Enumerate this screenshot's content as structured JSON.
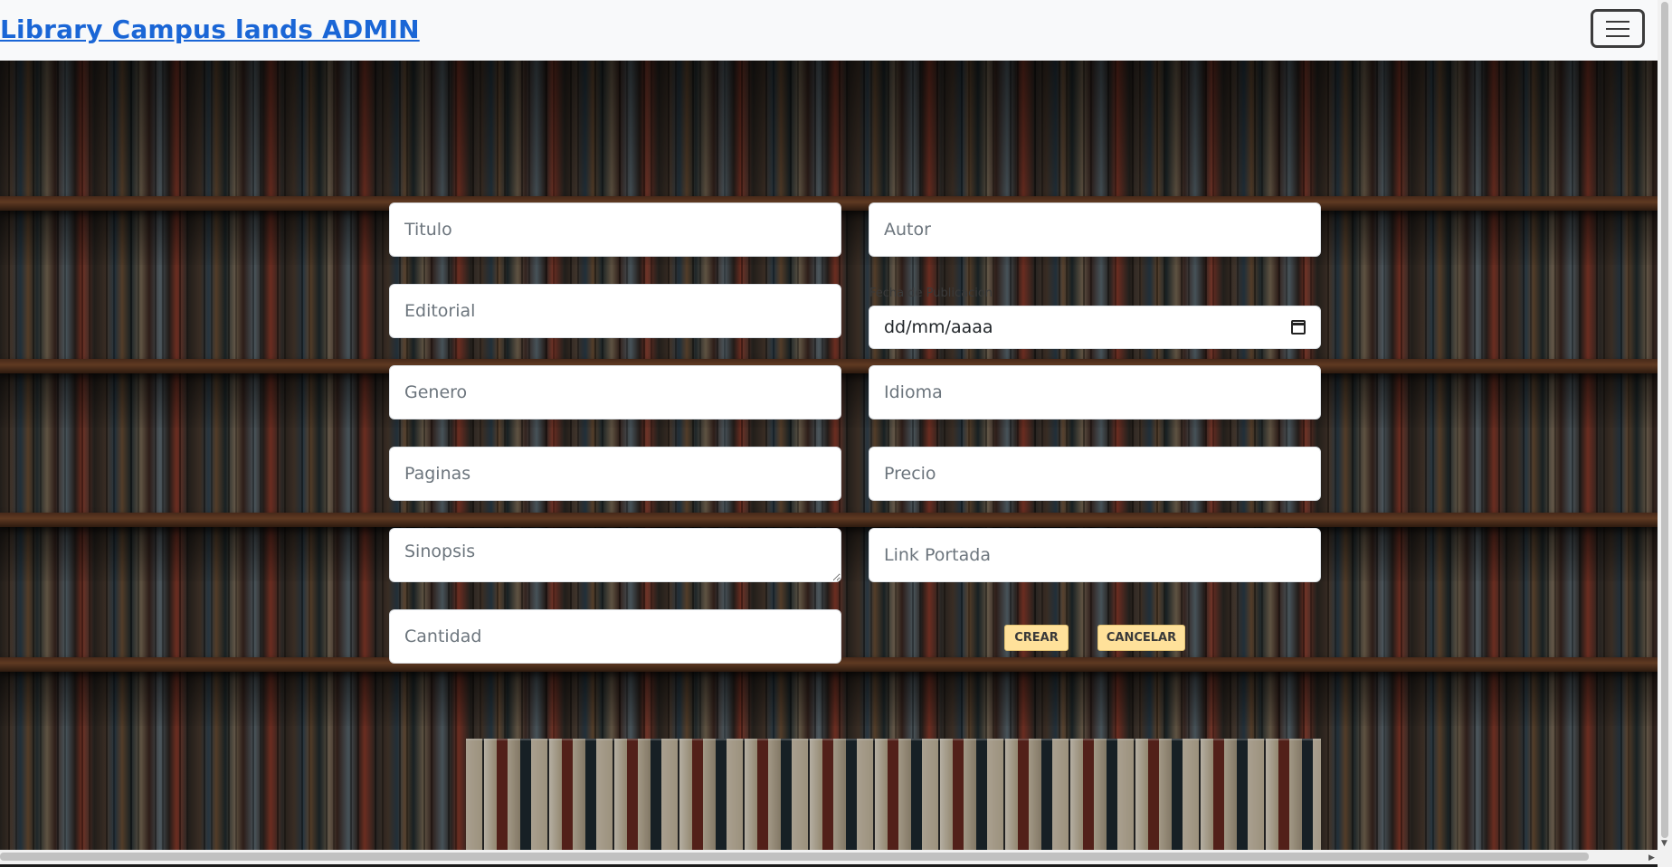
{
  "navbar": {
    "brand": "Library Campus lands ADMIN",
    "toggle_icon": "hamburger-menu-icon"
  },
  "form": {
    "titulo_placeholder": "Titulo",
    "autor_placeholder": "Autor",
    "editorial_placeholder": "Editorial",
    "fecha_label": "Fecha de Publicacion",
    "fecha_value": "dd/mm/aaaa",
    "fecha_icon": "calendar-icon",
    "genero_placeholder": "Genero",
    "idioma_placeholder": "Idioma",
    "paginas_placeholder": "Paginas",
    "precio_placeholder": "Precio",
    "sinopsis_placeholder": "Sinopsis",
    "link_portada_placeholder": "Link Portada",
    "cantidad_placeholder": "Cantidad",
    "crear_label": "CREAR",
    "cancelar_label": "CANCELAR"
  },
  "colors": {
    "brand_link": "#1a66d6",
    "button_bg": "#ffe19a",
    "navbar_bg": "#f8f9fa"
  }
}
